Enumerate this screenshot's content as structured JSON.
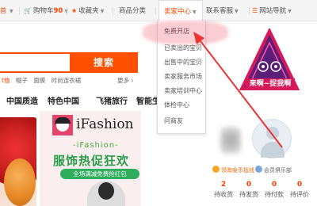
{
  "topnav": {
    "cart_label": "购物车",
    "cart_count": "90",
    "favorites_label": "收藏夹",
    "category_label": "商品分类",
    "seller_center_label": "卖家中心",
    "customer_service_label": "联系客服",
    "site_nav_label": "网站导航"
  },
  "seller_dropdown": {
    "items": [
      "免费开店",
      "已卖出的宝贝",
      "出售中的宝贝",
      "卖家服务市场",
      "卖家培训中心",
      "体检中心",
      "问商友"
    ]
  },
  "search": {
    "button_label": "搜索",
    "hot_words": [
      "t恤",
      "帽子",
      "面膜",
      "时尚连衣裙"
    ],
    "more_label": "更多"
  },
  "categories": [
    "中国质造",
    "特色中国",
    "飞猪旅行",
    "智能生"
  ],
  "banner": {
    "brand": "iFashion",
    "subtitle": "-iFashion-",
    "headline": "服饰热促狂欢",
    "pill": "全场满减免费抢红包"
  },
  "promo": {
    "text": "来啊~捉我啊"
  },
  "user_panel": {
    "gold_label": "领淘金币抵钱",
    "club_label": "会员俱乐部",
    "stats": [
      {
        "value": "2",
        "label": "待收货"
      },
      {
        "value": "0",
        "label": "待发货"
      },
      {
        "value": "0",
        "label": "待付款"
      },
      {
        "value": "0",
        "label": "待评价"
      }
    ]
  },
  "colors": {
    "accent": "#ff5000",
    "promo": "#d61a59",
    "banner_green": "#2a9d4b"
  }
}
